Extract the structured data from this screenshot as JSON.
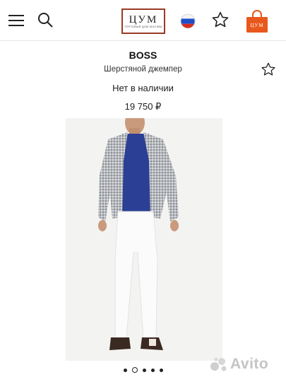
{
  "header": {
    "logo_text": "ЦУМ",
    "logo_subtext": "ТОРГОВЫЙ ДОМ МОСКВА",
    "icons": {
      "menu": "hamburger-menu-icon",
      "search": "search-icon",
      "region": "russia-flag-icon",
      "favorites": "star-icon",
      "bag": "shopping-bag-icon"
    },
    "bag_logo_text": "ЦУМ"
  },
  "product": {
    "brand": "BOSS",
    "name": "Шерстяной джемпер",
    "availability": "Нет в наличии",
    "price": "19 750 ₽",
    "wishlist_icon": "star-outline-icon"
  },
  "gallery": {
    "total_images": 5,
    "active_index": 1
  },
  "watermark": {
    "text": "Avito"
  },
  "colors": {
    "accent_orange": "#e8581c",
    "logo_border": "#9a3a24"
  }
}
